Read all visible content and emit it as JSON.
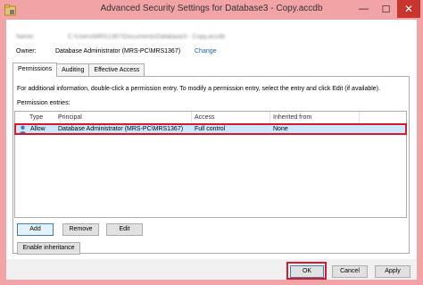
{
  "window": {
    "title": "Advanced Security Settings for Database3 - Copy.accdb",
    "minimize_glyph": "—",
    "maximize_glyph": "☐",
    "close_glyph": "✕",
    "app_icon": "folder-lock-icon"
  },
  "header": {
    "name_label": "Name:",
    "name_value": "C:\\Users\\MRS1367\\Documents\\Database3 - Copy.accdb",
    "owner_label": "Owner:",
    "owner_value": "Database Administrator (MRS-PC\\MRS1367)",
    "owner_change_link": "Change"
  },
  "tabs": [
    {
      "label": "Permissions",
      "active": true
    },
    {
      "label": "Auditing",
      "active": false
    },
    {
      "label": "Effective Access",
      "active": false
    }
  ],
  "permissions": {
    "info_text": "For additional information, double-click a permission entry. To modify a permission entry, select the entry and click Edit (if available).",
    "entries_label": "Permission entries:",
    "columns": [
      "Type",
      "Principal",
      "Access",
      "Inherited from"
    ],
    "rows": [
      {
        "icon": "user-icon",
        "type": "Allow",
        "principal": "Database Administrator (MRS-PC\\MRS1367)",
        "access": "Full control",
        "inherited_from": "None"
      }
    ]
  },
  "buttons": {
    "add": "Add",
    "remove": "Remove",
    "edit": "Edit",
    "enable_inheritance": "Enable inheritance",
    "ok": "OK",
    "cancel": "Cancel",
    "apply": "Apply"
  },
  "colors": {
    "highlight": "#d8192d",
    "selection": "#cce8ff",
    "titlebar": "#f2a3a6",
    "link": "#1a5fb4"
  }
}
